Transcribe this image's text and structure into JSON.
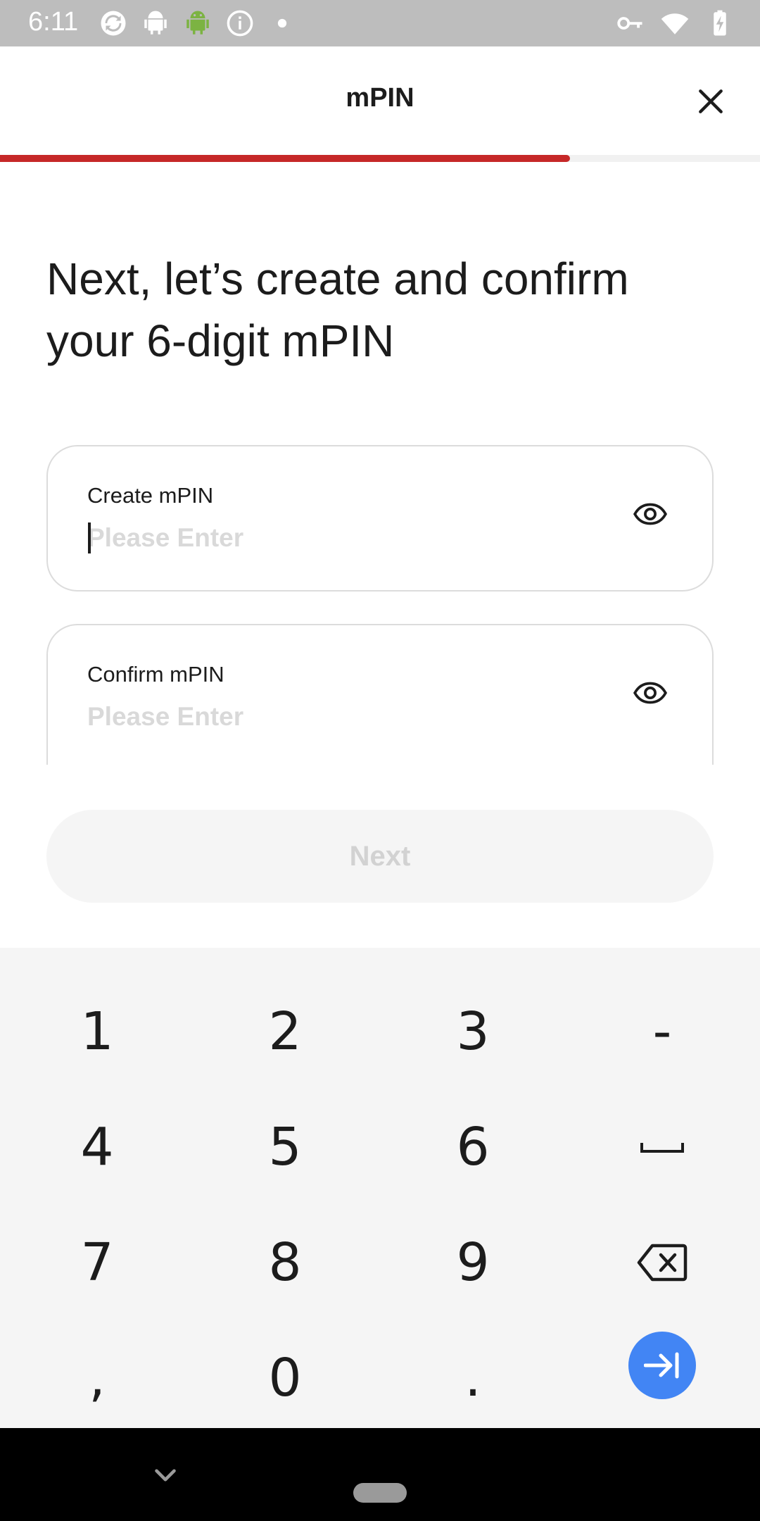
{
  "status_bar": {
    "time": "6:11",
    "left_icons": [
      "sync-icon",
      "android-outline-icon",
      "android-green-icon",
      "info-icon",
      "dot-icon"
    ],
    "right_icons": [
      "key-icon",
      "wifi-icon",
      "battery-charging-icon"
    ]
  },
  "header": {
    "title": "mPIN",
    "close_icon": "close-icon"
  },
  "progress": {
    "fraction": 0.75,
    "color": "#c62828"
  },
  "main": {
    "heading": "Next, let’s create and confirm your 6-digit mPIN"
  },
  "fields": {
    "create": {
      "label": "Create mPIN",
      "placeholder": "Please Enter",
      "value": ""
    },
    "confirm": {
      "label": "Confirm mPIN",
      "placeholder": "Please Enter",
      "value": ""
    }
  },
  "next_button": {
    "label": "Next"
  },
  "keyboard": {
    "rows": [
      [
        "1",
        "2",
        "3",
        "-"
      ],
      [
        "4",
        "5",
        "6",
        "space"
      ],
      [
        "7",
        "8",
        "9",
        "backspace"
      ],
      [
        ",",
        "0",
        ".",
        "enter"
      ]
    ],
    "keys": {
      "k1": "1",
      "k2": "2",
      "k3": "3",
      "dash": "-",
      "k4": "4",
      "k5": "5",
      "k6": "6",
      "k7": "7",
      "k8": "8",
      "k9": "9",
      "comma": ",",
      "k0": "0",
      "period": "."
    },
    "enter_color": "#4285f4"
  },
  "colors": {
    "accent_red": "#c62828",
    "keyboard_bg": "#f5f5f5",
    "placeholder": "#d9d9d9"
  }
}
